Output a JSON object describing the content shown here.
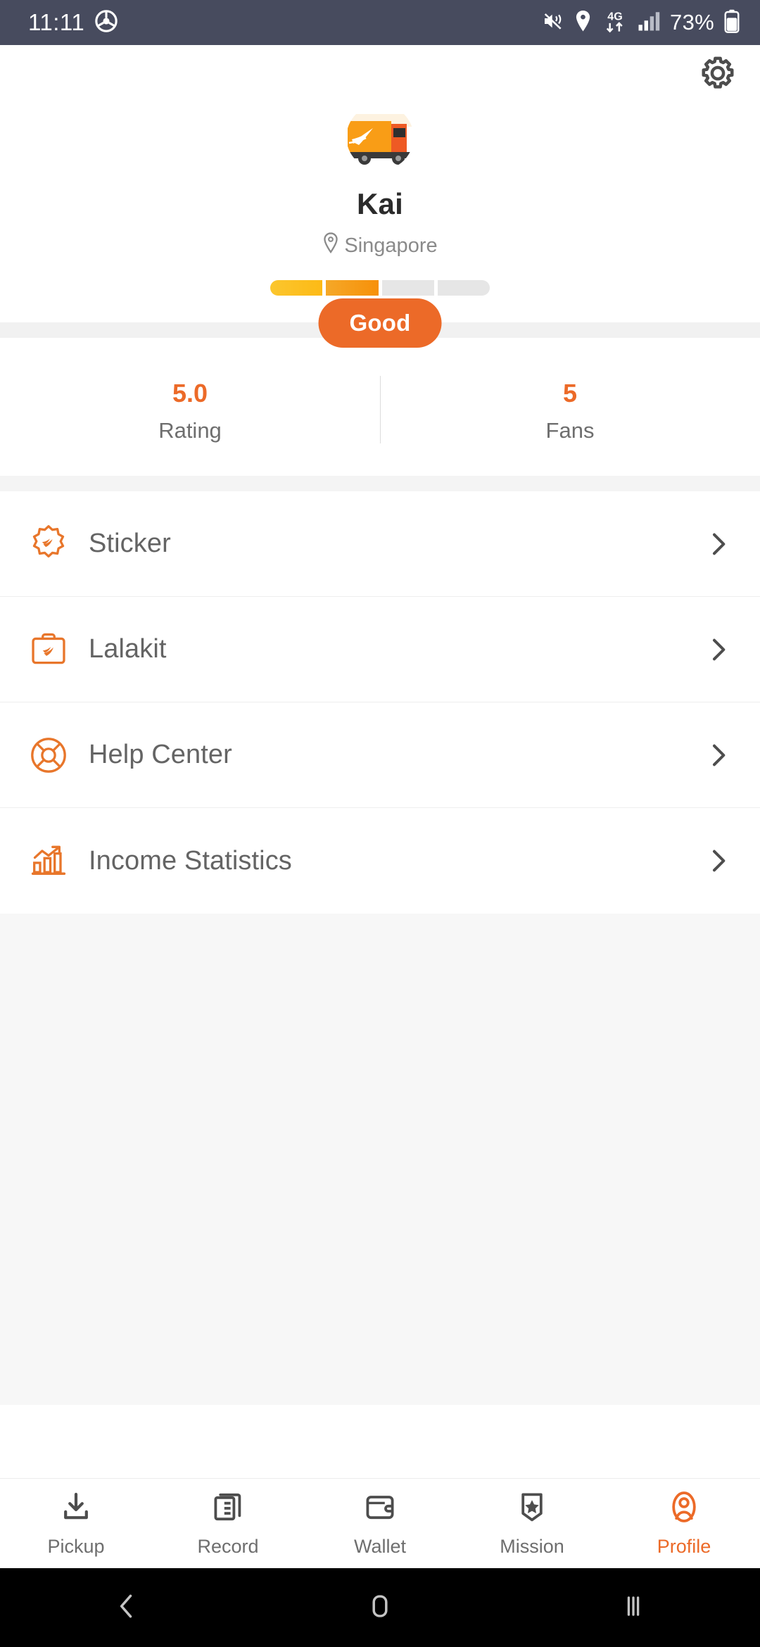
{
  "status_bar": {
    "time": "11:11",
    "driving_icon": "steering-wheel-icon",
    "mute_icon": "mute-vibrate-icon",
    "location_icon": "location-pin-icon",
    "network_label": "4G",
    "signal_icon": "signal-bars-icon",
    "battery_percent": "73%",
    "battery_icon": "battery-icon",
    "background_color": "#474B5E"
  },
  "header": {
    "settings_icon": "gear-icon"
  },
  "profile": {
    "avatar_icon": "delivery-truck-avatar",
    "name": "Kai",
    "location": "Singapore",
    "location_icon": "location-pin-icon",
    "level_segments": [
      {
        "state": "filled",
        "color": "#FBC62E"
      },
      {
        "state": "filled",
        "color": "#F79009"
      },
      {
        "state": "empty",
        "color": "#E6E6E6"
      },
      {
        "state": "empty",
        "color": "#E6E6E6"
      }
    ],
    "grade_badge": "Good",
    "grade_badge_color": "#EC6A28",
    "stats": [
      {
        "value": "5.0",
        "label": "Rating"
      },
      {
        "value": "5",
        "label": "Fans"
      }
    ],
    "accent_color": "#EC6A28"
  },
  "menu": {
    "items": [
      {
        "label": "Sticker",
        "icon": "sticker-badge-icon",
        "chevron": "chevron-right-icon"
      },
      {
        "label": "Lalakit",
        "icon": "toolkit-case-icon",
        "chevron": "chevron-right-icon"
      },
      {
        "label": "Help Center",
        "icon": "lifebuoy-icon",
        "chevron": "chevron-right-icon"
      },
      {
        "label": "Income Statistics",
        "icon": "bar-chart-trend-icon",
        "chevron": "chevron-right-icon"
      }
    ]
  },
  "tab_bar": {
    "active": "Profile",
    "tabs": [
      {
        "label": "Pickup",
        "icon": "download-tray-icon"
      },
      {
        "label": "Record",
        "icon": "document-list-icon"
      },
      {
        "label": "Wallet",
        "icon": "wallet-icon"
      },
      {
        "label": "Mission",
        "icon": "badge-star-icon"
      },
      {
        "label": "Profile",
        "icon": "person-oval-icon"
      }
    ]
  },
  "nav_bar": {
    "back": "back-chevron-icon",
    "home": "home-square-icon",
    "recents": "recents-bars-icon"
  }
}
